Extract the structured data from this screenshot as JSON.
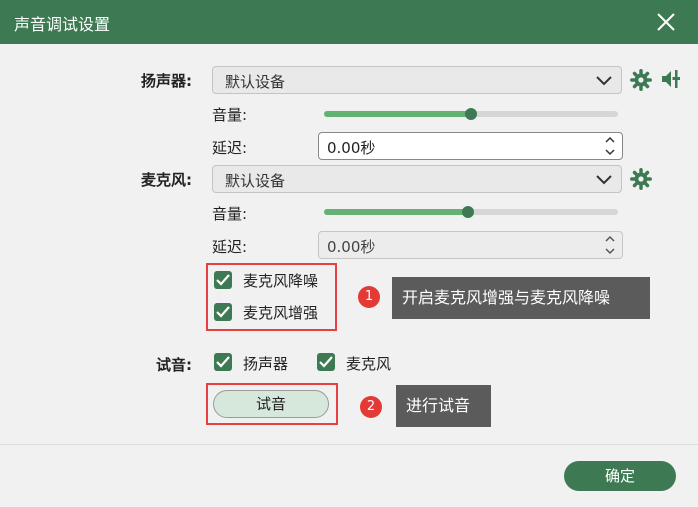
{
  "window": {
    "title": "声音调试设置"
  },
  "speaker": {
    "label": "扬声器:",
    "device": "默认设备",
    "volume_label": "音量:",
    "volume_level": 0.5,
    "delay_label": "延迟:",
    "delay_value": "0.00秒"
  },
  "mic": {
    "label": "麦克风:",
    "device": "默认设备",
    "volume_label": "音量:",
    "volume_level": 0.49,
    "delay_label": "延迟:",
    "delay_value": "0.00秒"
  },
  "options": {
    "noise_reduction": {
      "label": "麦克风降噪",
      "checked": true
    },
    "enhance": {
      "label": "麦克风增强",
      "checked": true
    }
  },
  "test": {
    "label": "试音:",
    "speaker_option": {
      "label": "扬声器",
      "checked": true
    },
    "mic_option": {
      "label": "麦克风",
      "checked": true
    },
    "button_label": "试音"
  },
  "annotations": {
    "step1": {
      "number": "1",
      "text": "开启麦克风增强与麦克风降噪"
    },
    "step2": {
      "number": "2",
      "text": "进行试音"
    }
  },
  "footer": {
    "ok_label": "确定"
  },
  "colors": {
    "primary": "#3d7a54",
    "slider_fill": "#63b274",
    "highlight": "#e8403e",
    "tip_bg": "#5b5b5b"
  },
  "icons": {
    "close": "close-icon",
    "chevron": "chevron-down-icon",
    "gear": "gear-icon",
    "speaker_adjust": "speaker-adjust-icon",
    "check": "check-icon"
  }
}
